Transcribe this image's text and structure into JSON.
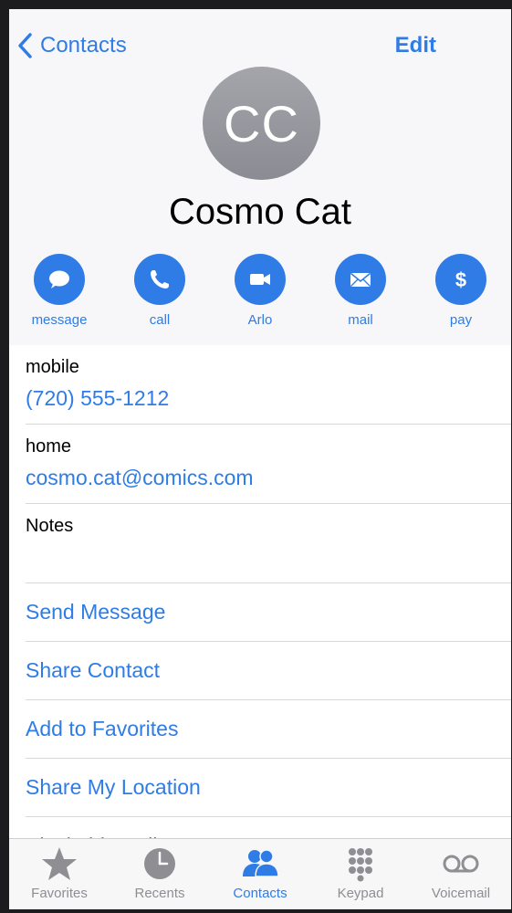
{
  "nav": {
    "back_label": "Contacts",
    "edit_label": "Edit"
  },
  "contact": {
    "initials": "CC",
    "name": "Cosmo Cat"
  },
  "actions": [
    {
      "label": "message",
      "icon": "message-bubble-icon"
    },
    {
      "label": "call",
      "icon": "phone-icon"
    },
    {
      "label": "Arlo",
      "icon": "video-camera-icon"
    },
    {
      "label": "mail",
      "icon": "envelope-icon"
    },
    {
      "label": "pay",
      "icon": "dollar-icon"
    }
  ],
  "fields": {
    "mobile": {
      "label": "mobile",
      "value": "(720) 555-1212"
    },
    "home": {
      "label": "home",
      "value": "cosmo.cat@comics.com"
    },
    "notes": {
      "label": "Notes",
      "value": ""
    }
  },
  "links": [
    "Send Message",
    "Share Contact",
    "Add to Favorites",
    "Share My Location",
    "Block this Caller"
  ],
  "tabs": [
    {
      "label": "Favorites",
      "icon": "star-icon",
      "active": false
    },
    {
      "label": "Recents",
      "icon": "clock-icon",
      "active": false
    },
    {
      "label": "Contacts",
      "icon": "contacts-icon",
      "active": true
    },
    {
      "label": "Keypad",
      "icon": "keypad-icon",
      "active": false
    },
    {
      "label": "Voicemail",
      "icon": "voicemail-icon",
      "active": false
    }
  ],
  "colors": {
    "accent": "#2f7ce6",
    "header_bg": "#f7f7f9",
    "tab_inactive": "#8e8e93",
    "avatar": "#9a9ba1"
  }
}
